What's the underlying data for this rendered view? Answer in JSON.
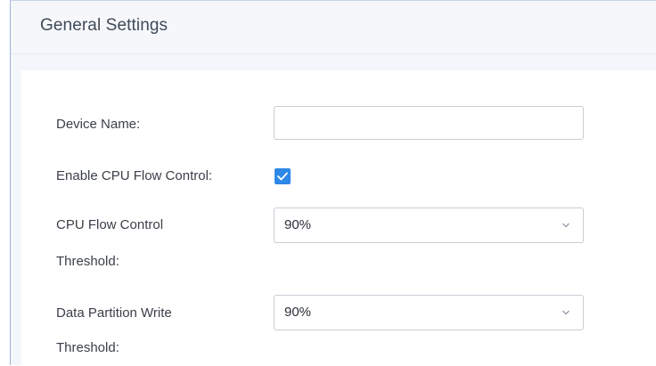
{
  "header": {
    "title": "General Settings"
  },
  "form": {
    "device_name": {
      "label": "Device Name:",
      "value": ""
    },
    "enable_cpu_flow_control": {
      "label": "Enable CPU Flow Control:",
      "checked": true
    },
    "cpu_flow_control_threshold": {
      "label_line1": "CPU Flow Control",
      "label_line2": "Threshold:",
      "value": "90%"
    },
    "data_partition_write_threshold": {
      "label_line1": "Data Partition Write",
      "label_line2": "Threshold:",
      "value": "90%"
    }
  },
  "icons": {
    "checkbox": "check-icon",
    "select_arrow": "chevron-down-icon"
  },
  "colors": {
    "accent": "#2e88e8",
    "header_bg": "#f5f7fa",
    "border": "#c8ced6"
  }
}
